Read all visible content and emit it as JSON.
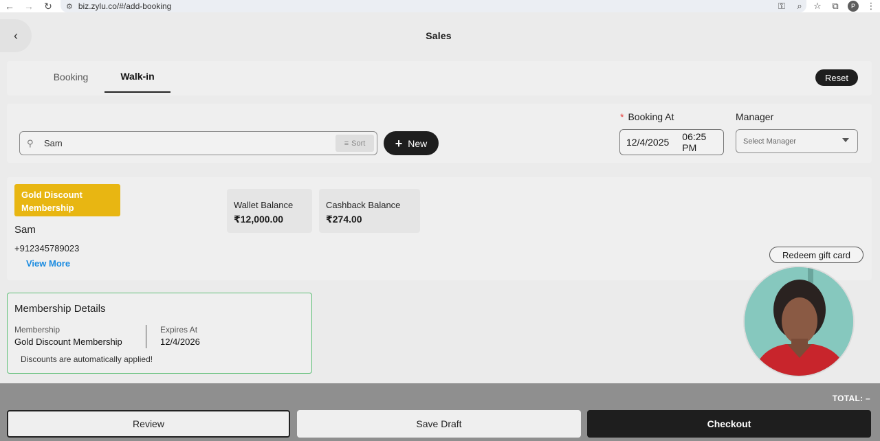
{
  "browser": {
    "url": "biz.zylu.co/#/add-booking",
    "profile_initial": "P"
  },
  "header": {
    "title": "Sales"
  },
  "tabs": [
    {
      "label": "Booking",
      "active": false
    },
    {
      "label": "Walk-in",
      "active": true
    }
  ],
  "reset_label": "Reset",
  "search": {
    "value": "Sam",
    "sort_label": "Sort"
  },
  "new_label": "New",
  "booking": {
    "label": "Booking At",
    "date": "12/4/2025",
    "time": "06:25 PM"
  },
  "manager": {
    "label": "Manager",
    "placeholder": "Select Manager"
  },
  "customer": {
    "badge": "Gold Discount Membership",
    "name": "Sam",
    "phone": "+912345789023",
    "view_more": "View More",
    "wallet_label": "Wallet Balance",
    "wallet_value": "₹12,000.00",
    "cashback_label": "Cashback Balance",
    "cashback_value": "₹274.00",
    "redeem_label": "Redeem gift card"
  },
  "membership": {
    "title": "Membership Details",
    "membership_label": "Membership",
    "membership_value": "Gold Discount Membership",
    "expires_label": "Expires At",
    "expires_value": "12/4/2026",
    "note": "Discounts are automatically applied!"
  },
  "footer": {
    "total": "TOTAL:  –",
    "review": "Review",
    "save_draft": "Save Draft",
    "checkout": "Checkout"
  },
  "colors": {
    "badge_gold": "#e8b612",
    "primary_dark": "#1e1e1e",
    "link_blue": "#1a8be0",
    "membership_border": "#5fbf77"
  }
}
